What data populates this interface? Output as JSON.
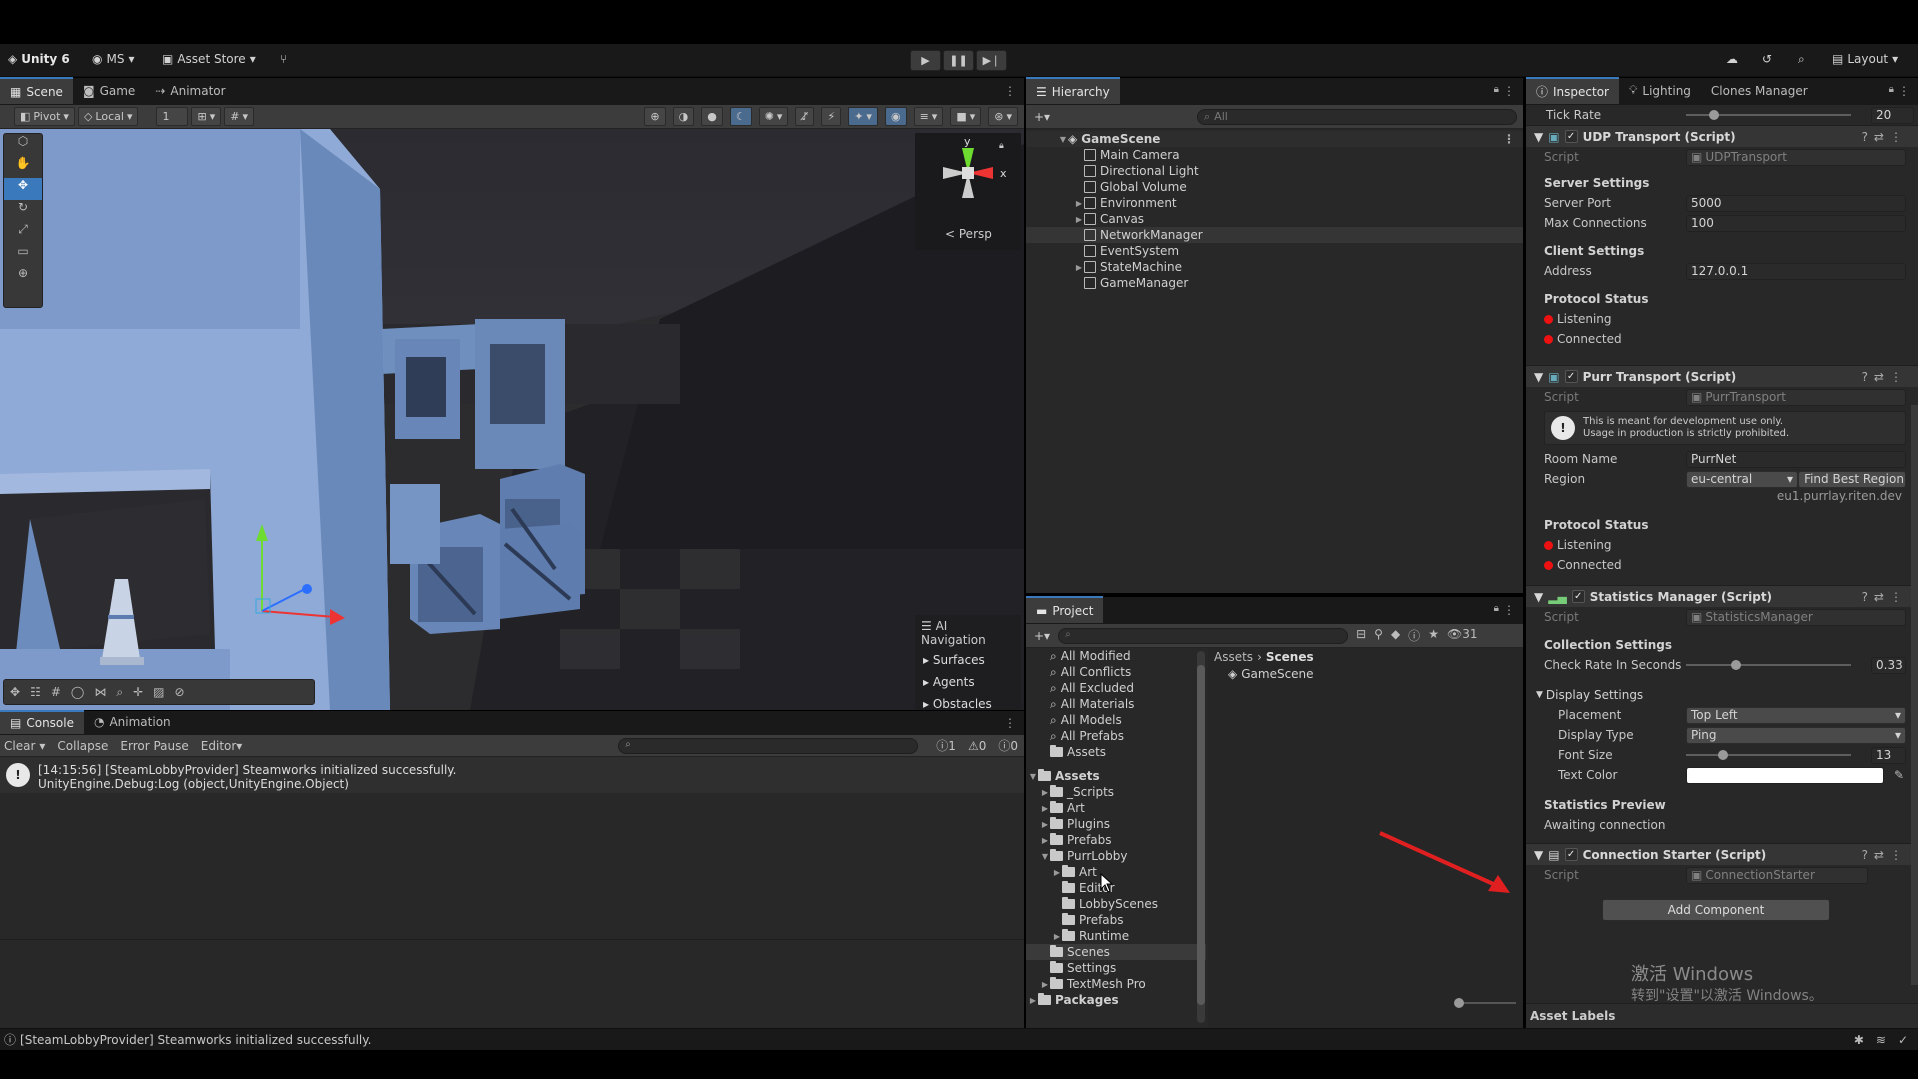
{
  "topbar": {
    "app_title": "Unity 6",
    "account": "MS",
    "asset_store": "Asset Store",
    "layout": "Layout"
  },
  "scene_panel": {
    "tabs": [
      "Scene",
      "Game",
      "Animator"
    ],
    "pivot": "Pivot",
    "local": "Local",
    "grid_value": "1",
    "persp_label": "Persp",
    "gizmo_y": "y",
    "gizmo_x": "x",
    "ai_nav": {
      "title": "AI Navigation",
      "items": [
        "Surfaces",
        "Agents",
        "Obstacles"
      ]
    }
  },
  "hierarchy": {
    "tab": "Hierarchy",
    "search_placeholder": "All",
    "scene": "GameScene",
    "items": [
      {
        "label": "Main Camera",
        "expand": false
      },
      {
        "label": "Directional Light",
        "expand": false
      },
      {
        "label": "Global Volume",
        "expand": false
      },
      {
        "label": "Environment",
        "expand": true
      },
      {
        "label": "Canvas",
        "expand": true
      },
      {
        "label": "NetworkManager",
        "expand": false
      },
      {
        "label": "EventSystem",
        "expand": false
      },
      {
        "label": "StateMachine",
        "expand": true
      },
      {
        "label": "GameManager",
        "expand": false
      }
    ]
  },
  "project": {
    "tab": "Project",
    "badge": "31",
    "favorites": [
      "All Modified",
      "All Conflicts",
      "All Excluded",
      "All Materials",
      "All Models",
      "All Prefabs",
      "Assets"
    ],
    "assets_root": "Assets",
    "folders": [
      "_Scripts",
      "Art",
      "Plugins",
      "Prefabs",
      "PurrLobby"
    ],
    "purrlobby_children": [
      "Art",
      "Editor",
      "LobbyScenes",
      "Prefabs",
      "Runtime"
    ],
    "tail_folders": [
      "Scenes",
      "Settings",
      "TextMesh Pro"
    ],
    "packages": "Packages",
    "breadcrumb": [
      "Assets",
      "Scenes"
    ],
    "files": [
      "GameScene"
    ]
  },
  "console": {
    "tabs": [
      "Console",
      "Animation"
    ],
    "clear": "Clear",
    "collapse": "Collapse",
    "error_pause": "Error Pause",
    "editor": "Editor",
    "count_log": "1",
    "count_warn": "0",
    "count_err": "0",
    "log_line1": "[14:15:56] [SteamLobbyProvider] Steamworks initialized successfully.",
    "log_line2": "UnityEngine.Debug:Log (object,UnityEngine.Object)"
  },
  "inspector": {
    "tabs": [
      "Inspector",
      "Lighting",
      "Clones Manager"
    ],
    "tick_rate_label": "Tick Rate",
    "tick_rate": "20",
    "udp": {
      "title": "UDP Transport (Script)",
      "script_label": "Script",
      "script": "UDPTransport",
      "server_settings": "Server Settings",
      "server_port_label": "Server Port",
      "server_port": "5000",
      "max_conn_label": "Max Connections",
      "max_conn": "100",
      "client_settings": "Client Settings",
      "address_label": "Address",
      "address": "127.0.0.1",
      "protocol_status": "Protocol Status",
      "listening": "Listening",
      "connected": "Connected"
    },
    "purr": {
      "title": "Purr Transport (Script)",
      "script_label": "Script",
      "script": "PurrTransport",
      "warn1": "This is meant for development use only.",
      "warn2": "Usage in production is strictly prohibited.",
      "room_label": "Room Name",
      "room": "PurrNet",
      "region_label": "Region",
      "region": "eu-central",
      "find_best": "Find Best Region",
      "region_host": "eu1.purrlay.riten.dev",
      "protocol_status": "Protocol Status",
      "listening": "Listening",
      "connected": "Connected"
    },
    "stats": {
      "title": "Statistics Manager (Script)",
      "script_label": "Script",
      "script": "StatisticsManager",
      "collection": "Collection Settings",
      "check_rate_label": "Check Rate In Seconds",
      "check_rate": "0.33",
      "display": "Display Settings",
      "placement_label": "Placement",
      "placement": "Top Left",
      "display_type_label": "Display Type",
      "display_type": "Ping",
      "font_size_label": "Font Size",
      "font_size": "13",
      "text_color_label": "Text Color",
      "preview": "Statistics Preview",
      "awaiting": "Awaiting connection"
    },
    "conn": {
      "title": "Connection Starter (Script)",
      "script_label": "Script",
      "script": "ConnectionStarter"
    },
    "add_component": "Add Component",
    "asset_labels": "Asset Labels",
    "watermark1": "激活 Windows",
    "watermark2": "转到\"设置\"以激活 Windows。"
  },
  "status_bar": {
    "message": "[SteamLobbyProvider] Steamworks initialized successfully."
  },
  "colors": {
    "accent": "#3a79bb",
    "status_red": "#e11111",
    "arrow_red": "#e02020"
  }
}
